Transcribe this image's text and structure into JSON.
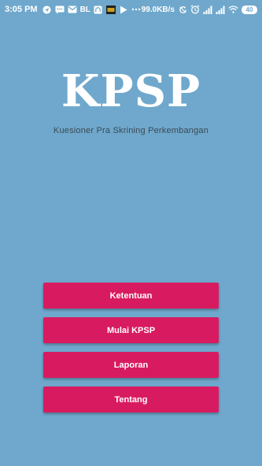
{
  "status_bar": {
    "time": "3:05 PM",
    "bl_label": "BL",
    "net_speed": "99.0KB/s",
    "battery": "40"
  },
  "app": {
    "logo": "KPSP",
    "subtitle": "Kuesioner Pra Skrining Perkembangan"
  },
  "menu": {
    "ketentuan": "Ketentuan",
    "mulai": "Mulai KPSP",
    "laporan": "Laporan",
    "tentang": "Tentang"
  },
  "colors": {
    "background": "#6fa8cc",
    "button": "#d81b60"
  }
}
